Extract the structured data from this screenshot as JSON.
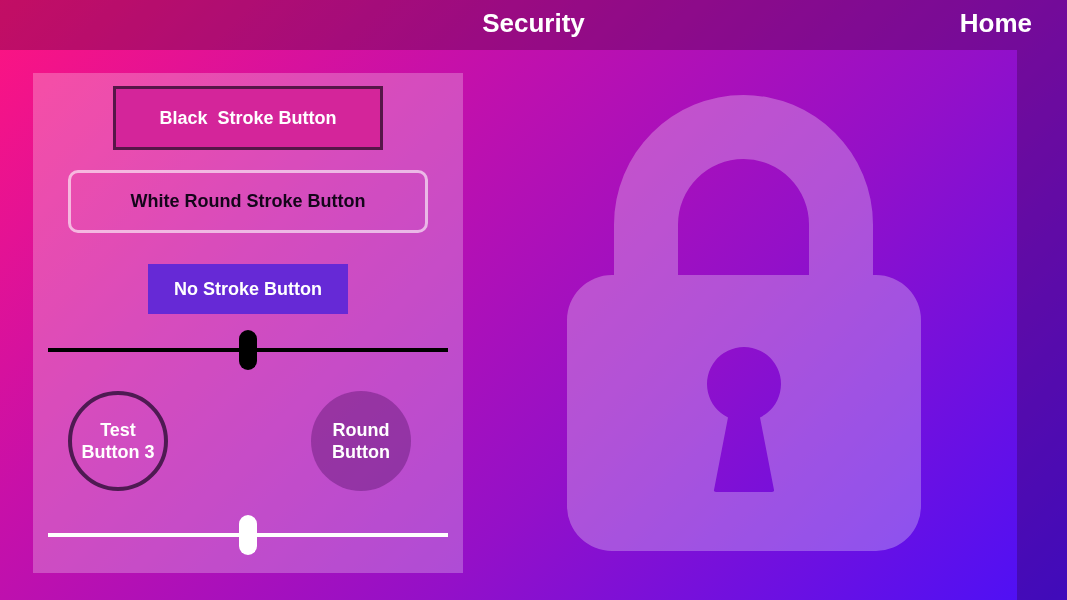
{
  "header": {
    "title": "Security",
    "home_link": "Home"
  },
  "panel": {
    "controls": [
      {
        "kind": "strokebutton",
        "label": "Black  Stroke Button"
      },
      {
        "kind": "roundbutton",
        "label": "White Round Stroke Button"
      },
      {
        "kind": "flatbutton",
        "label": "No Stroke Button"
      },
      {
        "kind": "darkslider",
        "level": 0.5
      },
      {
        "kind": "circlerow",
        "buttons": [
          {
            "kind": "ring",
            "label": "Test Button 3"
          },
          {
            "kind": "disc",
            "label": "Round Button"
          }
        ]
      },
      {
        "kind": "lightslider",
        "level": 0.5
      }
    ]
  }
}
